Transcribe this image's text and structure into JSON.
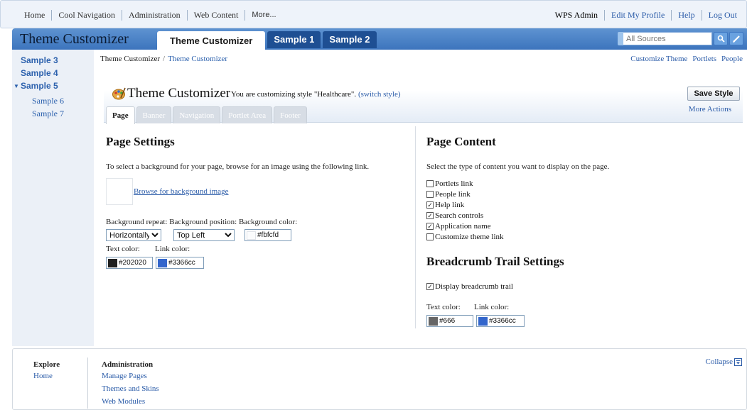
{
  "topbar": {
    "left_links": [
      "Home",
      "Cool Navigation",
      "Administration",
      "Web Content",
      "More..."
    ],
    "user": "WPS Admin",
    "right_links": [
      "Edit My Profile",
      "Help",
      "Log Out"
    ]
  },
  "banner": {
    "brand": "Theme Customizer",
    "tabs": [
      "Theme Customizer",
      "Sample 1",
      "Sample 2"
    ],
    "search_placeholder": "All Sources"
  },
  "sidebar": {
    "items": [
      "Sample 3",
      "Sample 4",
      "Sample 5"
    ],
    "subitems": [
      "Sample 6",
      "Sample 7"
    ],
    "expanded_marker": "▼"
  },
  "breadcrumb": {
    "root": "Theme Customizer",
    "separator": "/",
    "current": "Theme Customizer"
  },
  "page_actions": [
    "Customize Theme",
    "Portlets",
    "People"
  ],
  "customizer": {
    "title": "Theme Customizer",
    "style_text": "You are customizing style \"Healthcare\".",
    "switch_style": "(switch style)",
    "save_label": "Save Style",
    "more_actions": "More Actions",
    "tabs": [
      "Page",
      "Banner",
      "Navigation",
      "Portlet Area",
      "Footer"
    ],
    "active_tab": "Page"
  },
  "page_settings": {
    "heading": "Page Settings",
    "instruction": "To select a background for your page, browse for an image using the following link.",
    "browse_link": "Browse for background image",
    "labels_row": "Background repeat: Background position: Background color:",
    "repeat_value": "Horizontally",
    "position_value": "Top Left",
    "bg_color": "#fbfcfd",
    "text_color_label": "Text color:",
    "link_color_label": "Link color:",
    "text_color": "#202020",
    "link_color": "#3366cc"
  },
  "page_content": {
    "heading": "Page Content",
    "instruction": "Select the type of content you want to display on the page.",
    "options": [
      {
        "label": "Portlets link",
        "checked": false
      },
      {
        "label": "People link",
        "checked": false
      },
      {
        "label": "Help link",
        "checked": true
      },
      {
        "label": "Search controls",
        "checked": true
      },
      {
        "label": "Application name",
        "checked": true
      },
      {
        "label": "Customize theme link",
        "checked": false
      }
    ]
  },
  "breadcrumb_settings": {
    "heading": "Breadcrumb Trail Settings",
    "display_label": "Display breadcrumb trail",
    "display_checked": true,
    "text_color_label": "Text color:",
    "link_color_label": "Link color:",
    "text_color": "#666",
    "link_color": "#3366cc"
  },
  "footer": {
    "explore_title": "Explore",
    "explore_links": [
      "Home"
    ],
    "admin_title": "Administration",
    "admin_links": [
      "Manage Pages",
      "Themes and Skins",
      "Web Modules"
    ],
    "collapse_label": "Collapse"
  },
  "colors": {
    "banner_blue": "#3c74bd",
    "tab_dark": "#1e4f93",
    "link_blue": "#2a5ba8",
    "sidebar_bg": "#ebf0f7",
    "swatch_text": "#202020",
    "swatch_link": "#3366cc",
    "swatch_crumb_text": "#666666"
  }
}
